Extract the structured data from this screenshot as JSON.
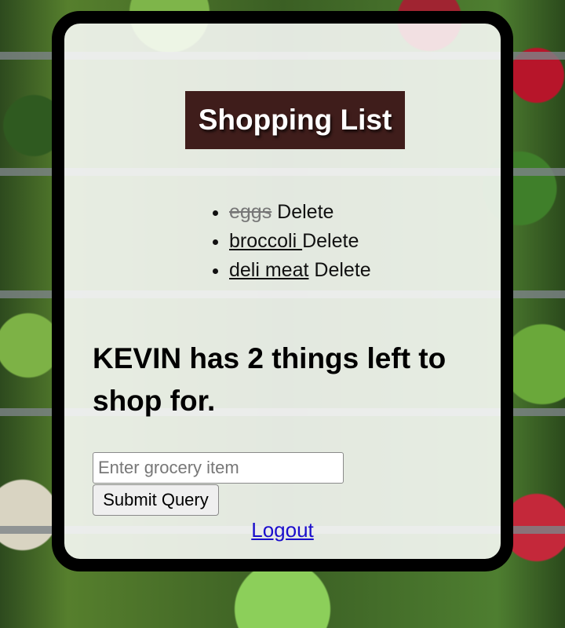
{
  "title": "Shopping List",
  "items": [
    {
      "name": "eggs",
      "completed": true,
      "delete_label": "Delete"
    },
    {
      "name": "broccoli ",
      "completed": false,
      "delete_label": "Delete"
    },
    {
      "name": "deli meat",
      "completed": false,
      "delete_label": "Delete"
    }
  ],
  "summary": "KEVIN has 2 things left to shop for.",
  "form": {
    "input_placeholder": "Enter grocery item",
    "input_value": "",
    "submit_label": "Submit Query"
  },
  "logout_label": "Logout",
  "colors": {
    "title_bg": "#3f1d1b",
    "completed_text": "#777777",
    "link": "#1a0dcc"
  }
}
